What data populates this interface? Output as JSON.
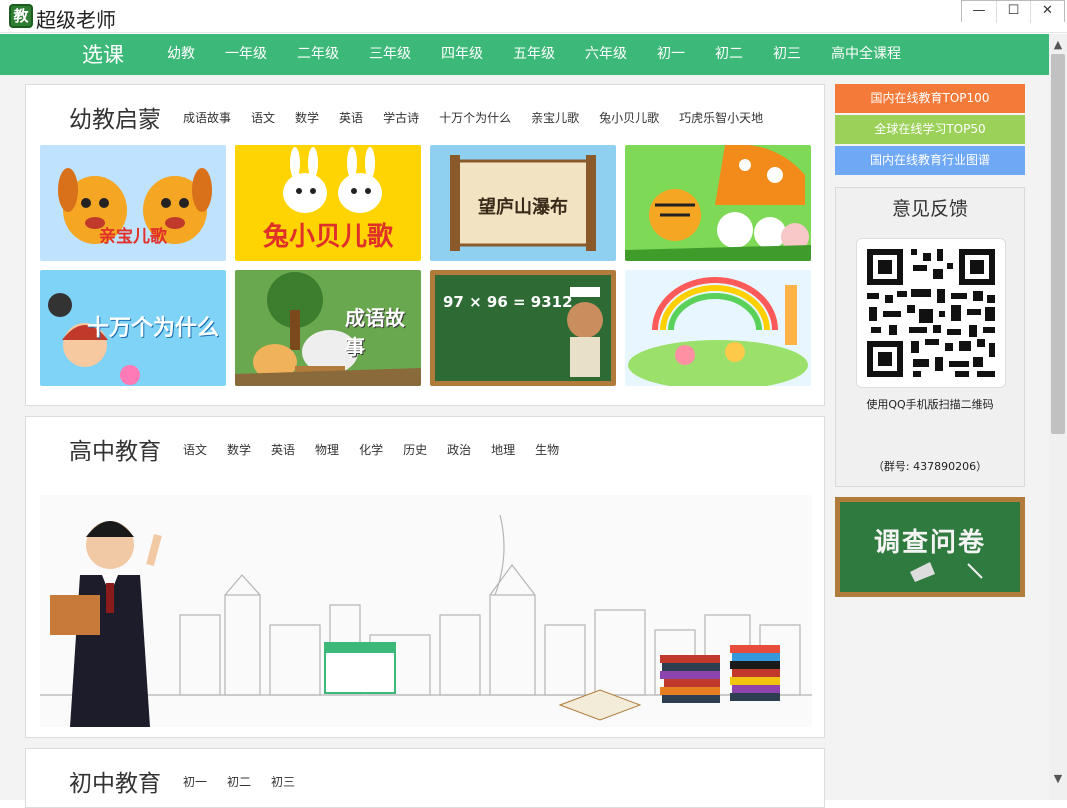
{
  "window": {
    "logo_char": "教",
    "title": "超级老师",
    "minimize": "—",
    "maximize": "☐",
    "close": "✕"
  },
  "nav": {
    "main": "选课",
    "items": [
      "幼教",
      "一年级",
      "二年级",
      "三年级",
      "四年级",
      "五年级",
      "六年级",
      "初一",
      "初二",
      "初三",
      "高中全课程"
    ]
  },
  "preschool": {
    "title": "幼教启蒙",
    "tags": [
      "成语故事",
      "语文",
      "数学",
      "英语",
      "学古诗",
      "十万个为什么",
      "亲宝儿歌",
      "兔小贝儿歌",
      "巧虎乐智小天地"
    ],
    "thumbs": [
      {
        "label": "亲宝儿歌",
        "bg": "#bfe3ff"
      },
      {
        "label": "兔小贝儿歌",
        "bg": "#ffd400"
      },
      {
        "label": "望庐山瀑布",
        "bg": "#8fd0f0"
      },
      {
        "label": "",
        "bg": "#7ed957"
      },
      {
        "label": "十万个为什么",
        "bg": "#7fd3f7"
      },
      {
        "label": "成语故事",
        "bg": "#6aa84f"
      },
      {
        "label": "97 × 96 = 9312",
        "bg": "#2e6b34"
      },
      {
        "label": "",
        "bg": "#e8f7ff"
      }
    ]
  },
  "highschool": {
    "title": "高中教育",
    "tags": [
      "语文",
      "数学",
      "英语",
      "物理",
      "化学",
      "历史",
      "政治",
      "地理",
      "生物"
    ]
  },
  "middleschool": {
    "title": "初中教育",
    "tags": [
      "初一",
      "初二",
      "初三"
    ]
  },
  "sidebar": {
    "buttons": [
      {
        "label": "国内在线教育TOP100",
        "color": "#f47a3a"
      },
      {
        "label": "全球在线学习TOP50",
        "color": "#9bd159"
      },
      {
        "label": "国内在线教育行业图谱",
        "color": "#6fa8f5"
      }
    ],
    "feedback_title": "意见反馈",
    "feedback_caption": "使用QQ手机版扫描二维码",
    "feedback_group": "（群号: 437890206）",
    "survey": "调查问卷"
  },
  "colors": {
    "nav_bg": "#3cb878"
  }
}
